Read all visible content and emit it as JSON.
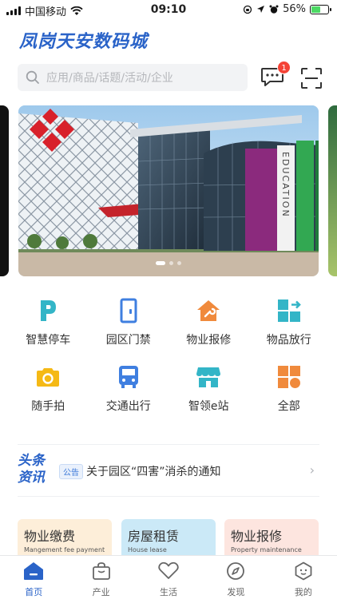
{
  "status_bar": {
    "carrier": "中国移动",
    "time": "09:10",
    "battery": "56%",
    "battery_level": 0.56
  },
  "header": {
    "title": "凤岗天安数码城",
    "search_placeholder": "应用/商品/话题/活动/企业",
    "message_badge": "1"
  },
  "banner": {
    "sign_text": "EDUCATION",
    "slide_count": 3,
    "active_slide": 1
  },
  "services": [
    {
      "label": "智慧停车",
      "icon": "parking-icon",
      "color": "#33b5c7"
    },
    {
      "label": "园区门禁",
      "icon": "door-icon",
      "color": "#3f7fe0"
    },
    {
      "label": "物业报修",
      "icon": "repair-icon",
      "color": "#f08a3c"
    },
    {
      "label": "物品放行",
      "icon": "item-release-icon",
      "color": "#33b5c7"
    },
    {
      "label": "随手拍",
      "icon": "camera-icon",
      "color": "#f5b915"
    },
    {
      "label": "交通出行",
      "icon": "bus-icon",
      "color": "#3f7fe0"
    },
    {
      "label": "智领e站",
      "icon": "shop-icon",
      "color": "#33b5c7"
    },
    {
      "label": "全部",
      "icon": "all-icon",
      "color": "#f08a3c"
    }
  ],
  "headline": {
    "logo_line1": "头条",
    "logo_line2": "资讯",
    "tag": "公告",
    "text": "关于园区“四害”消杀的通知"
  },
  "cards": [
    {
      "title": "物业缴费",
      "subtitle": "Mangement fee payment"
    },
    {
      "title": "房屋租赁",
      "subtitle": "House lease"
    },
    {
      "title": "物业报修",
      "subtitle": "Property maintenance"
    }
  ],
  "tabs": [
    {
      "label": "首页",
      "icon": "home-icon",
      "active": true
    },
    {
      "label": "产业",
      "icon": "bag-icon",
      "active": false
    },
    {
      "label": "生活",
      "icon": "heart-icon",
      "active": false
    },
    {
      "label": "发现",
      "icon": "compass-icon",
      "active": false
    },
    {
      "label": "我的",
      "icon": "profile-icon",
      "active": false
    }
  ],
  "colors": {
    "brand": "#2a63c8",
    "badge": "#f44336",
    "inactive_tab": "#666666"
  }
}
